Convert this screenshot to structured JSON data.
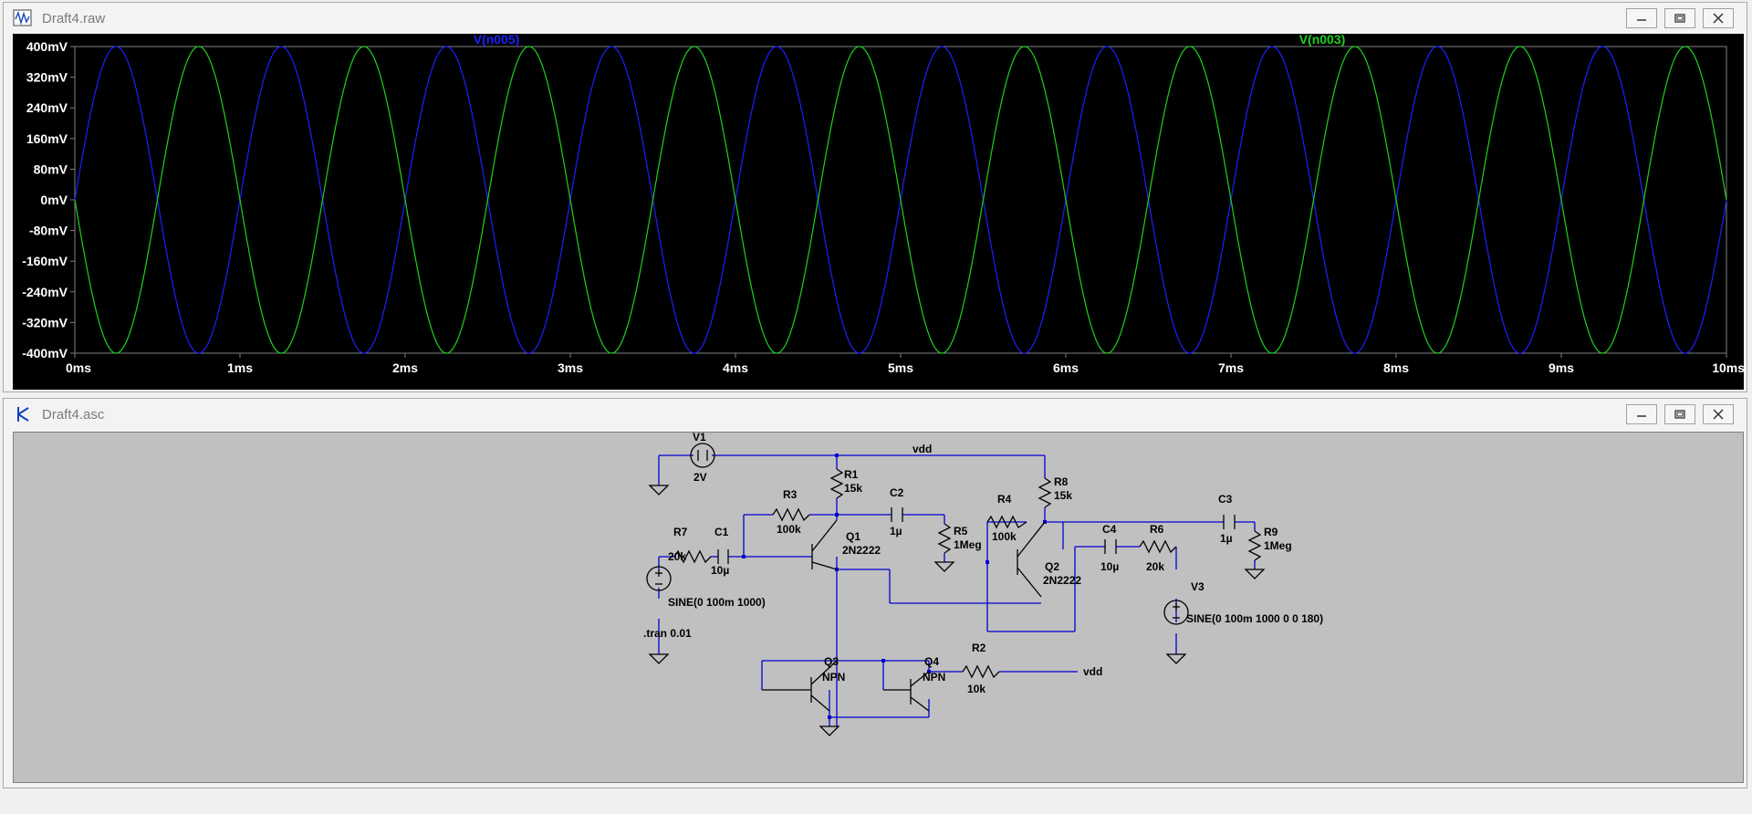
{
  "waveform_window": {
    "title": "Draft4.raw",
    "chart_data": {
      "type": "line",
      "x_ticks": [
        "0ms",
        "1ms",
        "2ms",
        "3ms",
        "4ms",
        "5ms",
        "6ms",
        "7ms",
        "8ms",
        "9ms",
        "10ms"
      ],
      "y_ticks": [
        "400mV",
        "320mV",
        "240mV",
        "160mV",
        "80mV",
        "0mV",
        "-80mV",
        "-160mV",
        "-240mV",
        "-320mV",
        "-400mV"
      ],
      "xlim": [
        0,
        10
      ],
      "ylim": [
        -400,
        400
      ],
      "series": [
        {
          "name": "V(n005)",
          "color": "#1f1fff",
          "amplitude_mV": 400,
          "frequency_kHz": 1,
          "phase_deg": 0
        },
        {
          "name": "V(n003)",
          "color": "#1ed21e",
          "amplitude_mV": 400,
          "frequency_kHz": 1,
          "phase_deg": 180
        }
      ]
    }
  },
  "schematic_window": {
    "title": "Draft4.asc",
    "labels": {
      "v1": "V1",
      "v1_val": "2V",
      "vdd_top": "vdd",
      "r1": "R1",
      "r1_val": "15k",
      "r8": "R8",
      "r8_val": "15k",
      "r3": "R3",
      "r3_val": "100k",
      "c2": "C2",
      "c2_val": "1µ",
      "r5": "R5",
      "r5_val": "1Meg",
      "r4": "R4",
      "r4_val": "100k",
      "c3": "C3",
      "c3_val": "1µ",
      "r9": "R9",
      "r9_val": "1Meg",
      "r7": "R7",
      "r7_val": "20k",
      "c1": "C1",
      "c1_val": "10µ",
      "q1": "Q1",
      "q1_val": "2N2222",
      "q2": "Q2",
      "q2_val": "2N2222",
      "c4": "C4",
      "c4_val": "10µ",
      "r6": "R6",
      "r6_val": "20k",
      "v2_val": "SINE(0 100m 1000)",
      "v3": "V3",
      "v3_val": "SINE(0 100m 1000 0 0 180)",
      "tran": ".tran 0.01",
      "q3": "Q3",
      "q3_val": "NPN",
      "q4": "Q4",
      "q4_val": "NPN",
      "r2": "R2",
      "r2_val": "10k",
      "vdd_right": "vdd"
    }
  },
  "colors": {
    "wire": "#0000d0",
    "component": "#000000",
    "plot_axis": "#808080",
    "axis_text": "#ffffff"
  }
}
